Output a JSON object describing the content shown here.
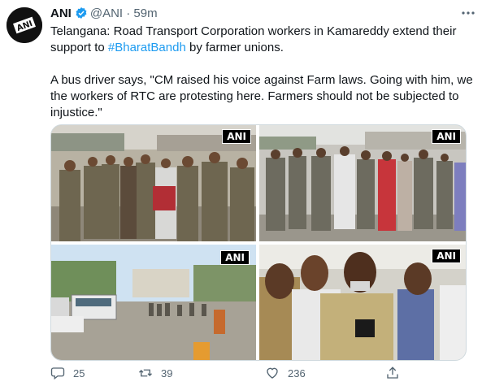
{
  "author": {
    "name": "ANI",
    "handle": "@ANI",
    "separator": "·",
    "time": "59m"
  },
  "avatar": {
    "label": "ANI"
  },
  "tweet": {
    "line1": "Telangana: Road Transport Corporation workers in Kamareddy extend their support to ",
    "hashtag": "#BharatBandh",
    "line1_tail": " by farmer unions.",
    "quote": "A bus driver says, \"CM raised his voice against Farm laws. Going with him, we the workers of RTC are protesting here. Farmers should not be subjected to injustice.\""
  },
  "media": {
    "watermark": "ANI"
  },
  "actions": {
    "replies": "25",
    "retweets": "39",
    "likes": "236"
  },
  "colors": {
    "link": "#1d9bf0",
    "muted": "#536471",
    "verified": "#1d9bf0"
  }
}
